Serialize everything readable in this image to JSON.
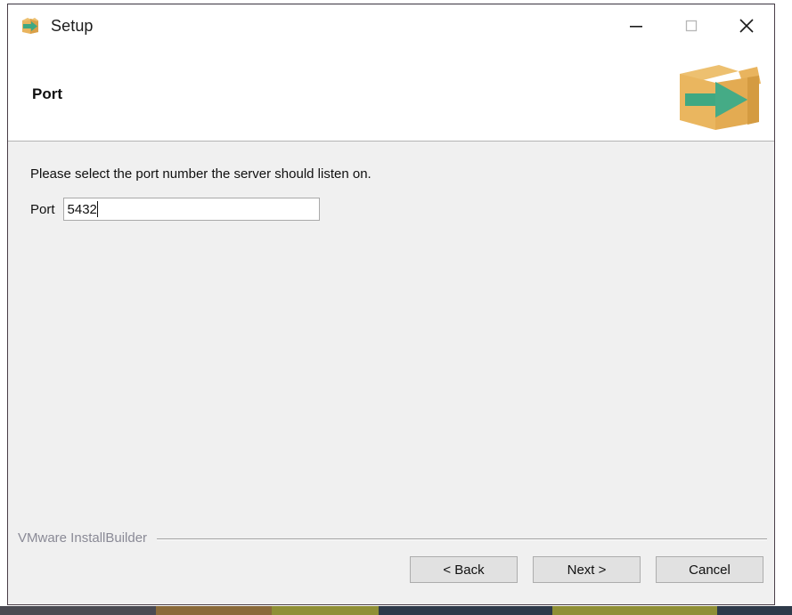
{
  "window": {
    "title": "Setup",
    "title_icon": "installbuilder-box-arrow-icon",
    "controls": {
      "minimize_label": "Minimize",
      "minimize_icon": "minimize-icon",
      "maximize_label": "Maximize",
      "maximize_icon": "maximize-icon",
      "close_label": "Close",
      "close_icon": "close-icon"
    }
  },
  "header": {
    "page_title": "Port",
    "logo_icon": "open-box-green-arrow-logo",
    "logo_colors": {
      "box_front": "#e9b45e",
      "box_side": "#d9a048",
      "box_flap": "#edc070",
      "arrow": "#3fa882",
      "arrow_shadow": "#2f8f6c"
    }
  },
  "main": {
    "instruction": "Please select the port number the server should listen on.",
    "port_field": {
      "label": "Port",
      "value": "5432",
      "placeholder": "",
      "caret_visible": true
    }
  },
  "footer": {
    "brand": "VMware InstallBuilder",
    "buttons": [
      {
        "id": "back",
        "label": "< Back"
      },
      {
        "id": "next",
        "label": "Next >"
      },
      {
        "id": "cancel",
        "label": "Cancel"
      }
    ]
  },
  "desktop": {
    "strip_segments": [
      {
        "color": "#4a4a52",
        "width": 175
      },
      {
        "color": "#8a6a3a",
        "width": 130
      },
      {
        "color": "#8f8f36",
        "width": 120
      },
      {
        "color": "#2e3a4a",
        "width": 195
      },
      {
        "color": "#8f8f36",
        "width": 185
      },
      {
        "color": "#2e3a4a",
        "width": 84
      }
    ]
  },
  "colors": {
    "window_border": "#4a3f48",
    "body_background": "#f0f0f0",
    "header_background": "#ffffff",
    "button_face": "#e1e1e1",
    "button_border": "#adadad",
    "input_border": "#a9a9a9",
    "brand_text": "#8a8a96",
    "text_primary": "#101010"
  }
}
